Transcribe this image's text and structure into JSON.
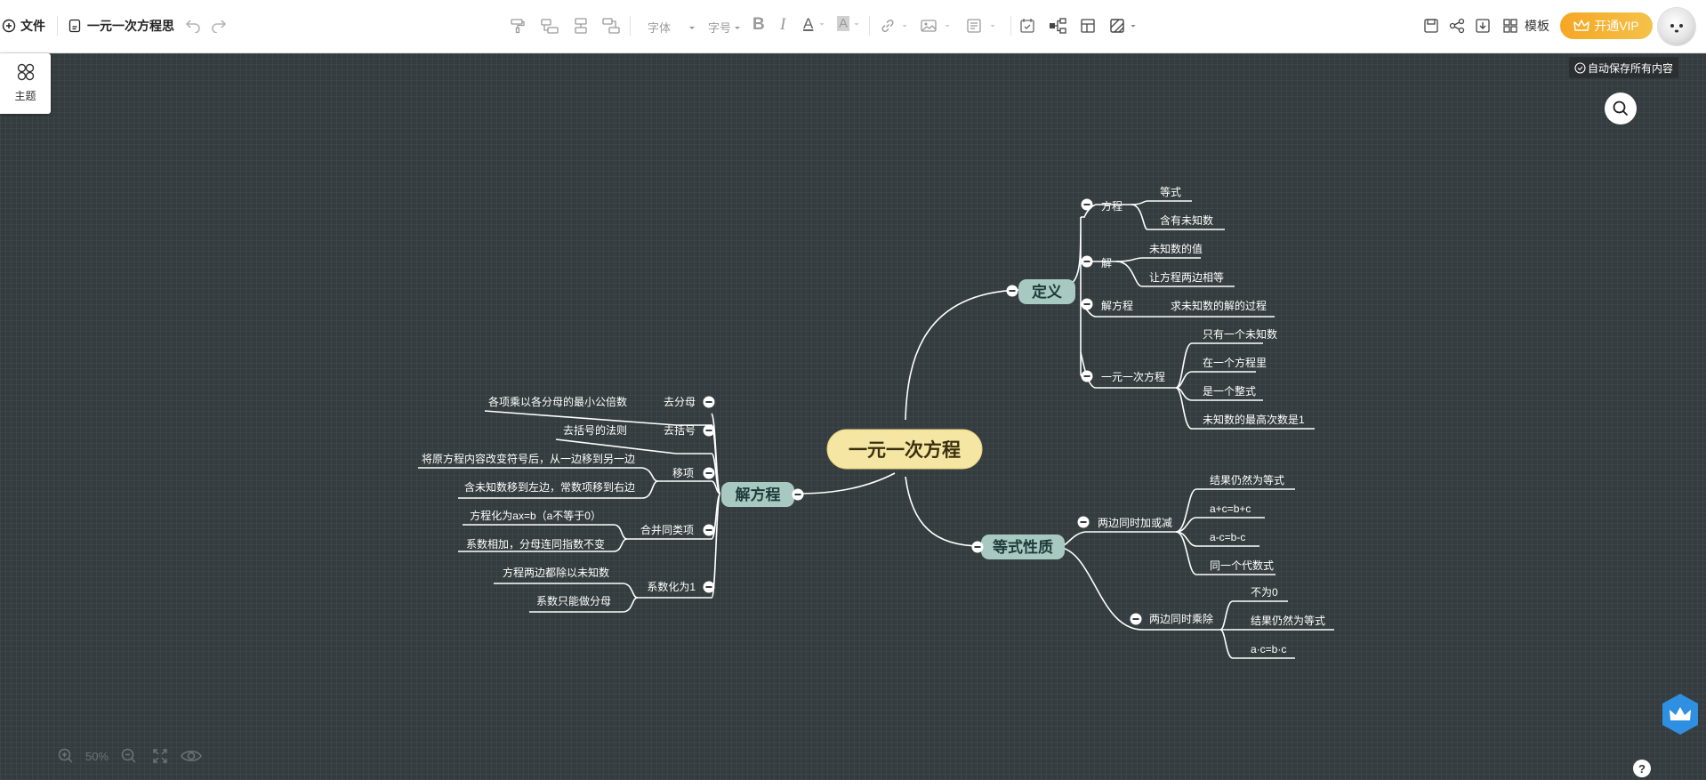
{
  "toolbar": {
    "file_label": "文件",
    "doc_title": "一元一次方程思",
    "font_label": "字体",
    "size_label": "字号",
    "bold_glyph": "B",
    "italic_glyph": "I",
    "font_color_glyph": "A",
    "highlight_glyph": "A",
    "template_label": "模板",
    "vip_label": "开通VIP"
  },
  "side_panel": {
    "theme_label": "主题"
  },
  "status": {
    "autosave": "自动保存所有内容"
  },
  "zoom": {
    "level": "50%"
  },
  "help": {
    "label": "?"
  },
  "mindmap": {
    "root": "一元一次方程",
    "branches": {
      "definition": {
        "label": "定义",
        "fangcheng": {
          "label": "方程",
          "items": [
            "等式",
            "含有未知数"
          ]
        },
        "jie": {
          "label": "解",
          "items": [
            "未知数的值",
            "让方程两边相等"
          ]
        },
        "jiefangcheng": {
          "label": "解方程",
          "items": [
            "求未知数的解的过程"
          ]
        },
        "yiyuan": {
          "label": "一元一次方程",
          "items": [
            "只有一个未知数",
            "在一个方程里",
            "是一个整式",
            "未知数的最高次数是1"
          ]
        }
      },
      "properties": {
        "label": "等式性质",
        "addsub": {
          "label": "两边同时加或减",
          "items": [
            "结果仍然为等式",
            "a+c=b+c",
            "a-c=b-c",
            "同一个代数式"
          ]
        },
        "mult": {
          "label": "两边同时乘除",
          "items": [
            "不为0",
            "结果仍然为等式",
            "a·c=b·c"
          ]
        }
      },
      "solving": {
        "label": "解方程",
        "qufenmu": {
          "label": "去分母",
          "items": [
            "各项乘以各分母的最小公倍数"
          ]
        },
        "qukuohao": {
          "label": "去括号",
          "items": [
            "去括号的法则"
          ]
        },
        "yixiang": {
          "label": "移项",
          "items": [
            "将原方程内容改变符号后，从一边移到另一边",
            "含未知数移到左边，常数项移到右边"
          ]
        },
        "hebing": {
          "label": "合并同类项",
          "items": [
            "方程化为ax=b（a不等于0）",
            "系数相加，分母连同指数不变"
          ]
        },
        "xishu": {
          "label": "系数化为1",
          "items": [
            "方程两边都除以未知数",
            "系数只能做分母"
          ]
        }
      }
    }
  }
}
